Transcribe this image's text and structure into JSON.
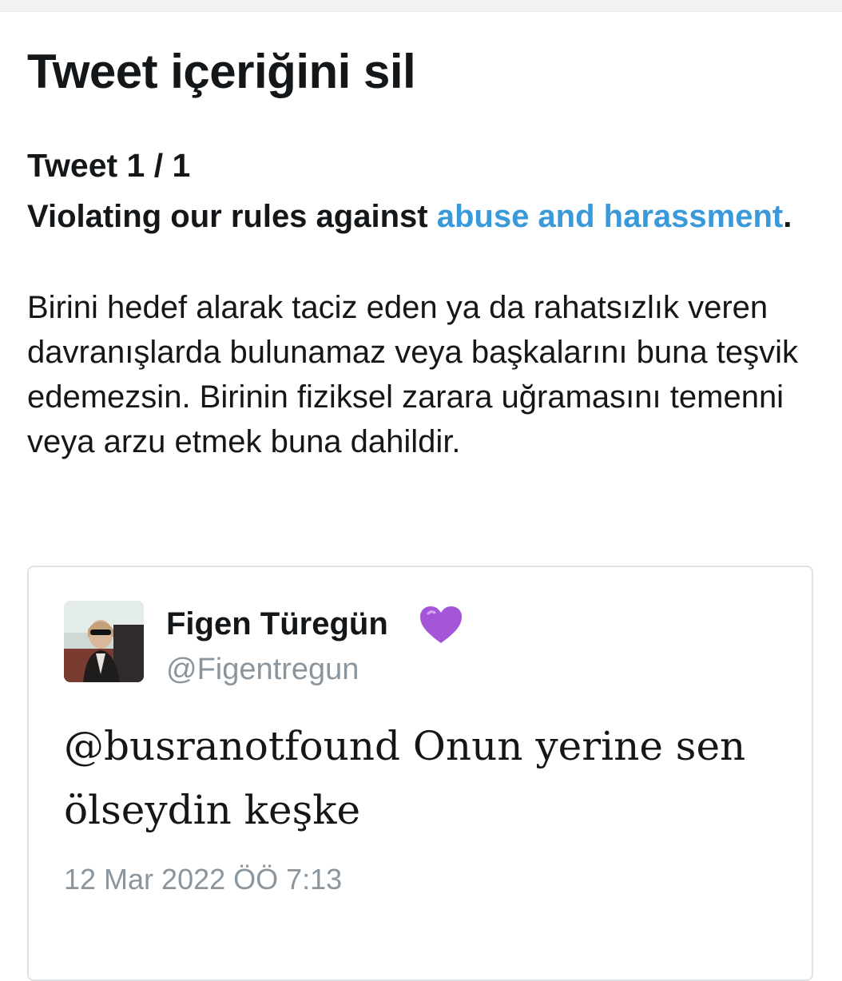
{
  "page": {
    "title": "Tweet içeriğini sil"
  },
  "report": {
    "count_label": "Tweet 1 / 1",
    "violation_prefix": "Violating our rules against ",
    "violation_link": "abuse and harassment",
    "violation_suffix": ".",
    "description": "Birini hedef alarak taciz eden ya da rahatsızlık veren davranışlarda bulunamaz veya başkalarını buna teşvik edemezsin. Birinin fiziksel zarara uğramasını temenni veya arzu etmek buna dahildir."
  },
  "tweet": {
    "author_name": "Figen Türegün",
    "author_handle": "@Figentregun",
    "badge_icon": "purple-heart-icon",
    "text": "@busranotfound Onun yerine sen ölseydin keşke",
    "timestamp": "12 Mar 2022 ÖÖ 7:13"
  },
  "colors": {
    "link": "#3a9ad9",
    "muted": "#8a959e",
    "heart": "#a555d8",
    "text": "#14171a"
  }
}
